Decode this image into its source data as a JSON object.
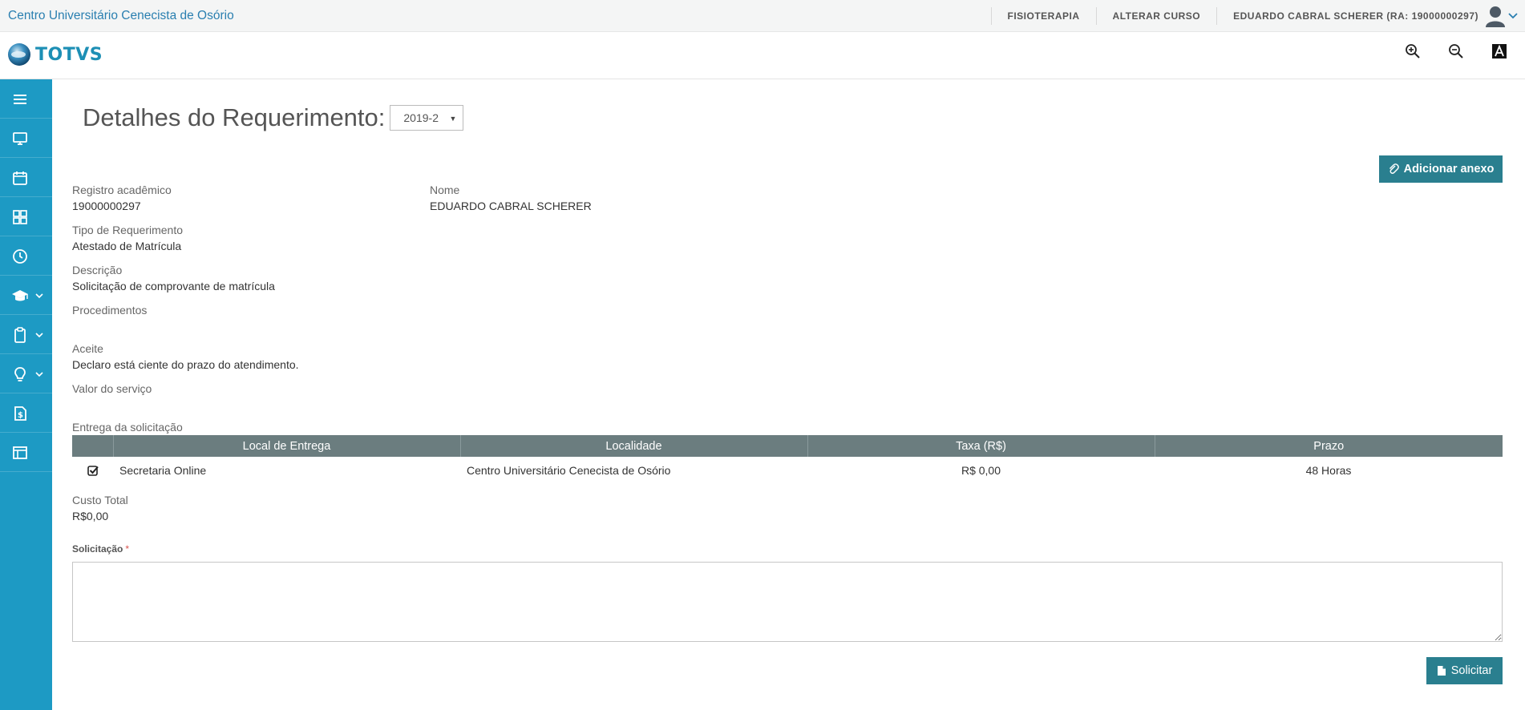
{
  "topbar": {
    "institution": "Centro Universitário Cenecista de Osório",
    "course": "FISIOTERAPIA",
    "change_course": "ALTERAR CURSO",
    "user": "EDUARDO CABRAL SCHERER (RA: 19000000297)"
  },
  "header": {
    "logo_text": "TOTVS"
  },
  "sidebar": {
    "items": [
      {
        "icon": "menu-icon"
      },
      {
        "icon": "monitor-icon"
      },
      {
        "icon": "calendar-icon"
      },
      {
        "icon": "grid-icon"
      },
      {
        "icon": "clock-icon"
      },
      {
        "icon": "graduation-cap-icon",
        "submenu": true
      },
      {
        "icon": "clipboard-icon",
        "submenu": true
      },
      {
        "icon": "lightbulb-icon",
        "submenu": true
      },
      {
        "icon": "dollar-document-icon"
      },
      {
        "icon": "layout-icon"
      }
    ]
  },
  "page": {
    "title": "Detalhes do Requerimento:",
    "period_selected": "2019-2",
    "add_attachment_label": "Adicionar anexo",
    "submit_label": "Solicitar"
  },
  "details": {
    "registro_label": "Registro acadêmico",
    "registro_value": "19000000297",
    "nome_label": "Nome",
    "nome_value": "EDUARDO CABRAL SCHERER",
    "tipo_label": "Tipo de Requerimento",
    "tipo_value": "Atestado de Matrícula",
    "descricao_label": "Descrição",
    "descricao_value": "Solicitação de comprovante de matrícula",
    "procedimentos_label": "Procedimentos",
    "aceite_label": "Aceite",
    "aceite_value": "Declaro está ciente do prazo do atendimento.",
    "valor_label": "Valor do serviço",
    "entrega_label": "Entrega da solicitação",
    "custo_label": "Custo Total",
    "custo_value": "R$0,00",
    "solicitacao_label": "Solicitação",
    "required_mark": "*"
  },
  "entrega_table": {
    "headers": [
      "Local de Entrega",
      "Localidade",
      "Taxa (R$)",
      "Prazo"
    ],
    "rows": [
      {
        "checked": true,
        "local": "Secretaria Online",
        "localidade": "Centro Universitário Cenecista de Osório",
        "taxa": "R$ 0,00",
        "prazo": "48 Horas"
      }
    ]
  },
  "colors": {
    "sidebar": "#1d9ac4",
    "button": "#2a7f8f",
    "table_header": "#6b7d7f",
    "institution_link": "#2a7fb0"
  }
}
